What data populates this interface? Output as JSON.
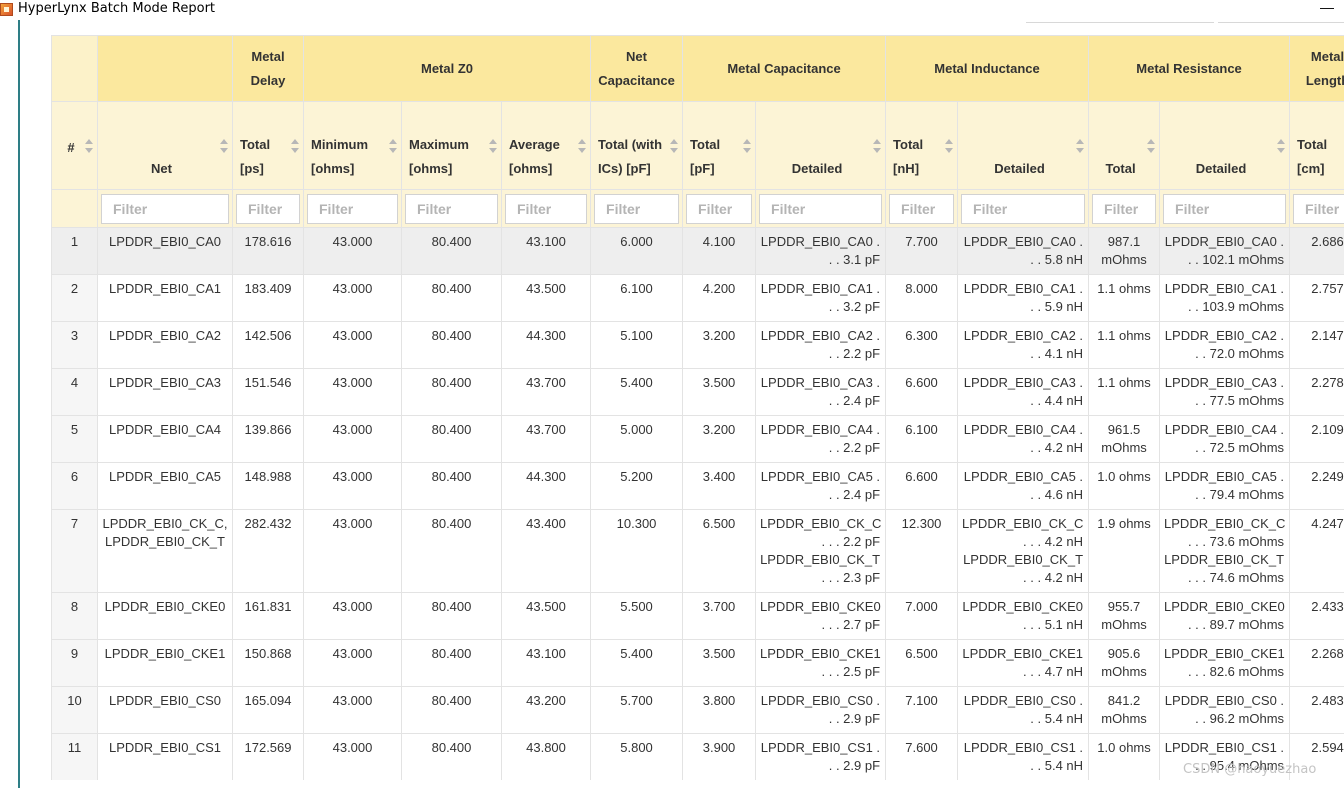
{
  "window": {
    "title": "HyperLynx Batch Mode Report",
    "minimize_glyph": "—",
    "app_icon": "hyperlynx-app-icon"
  },
  "header": {
    "groups": [
      "",
      "",
      "Metal Delay",
      "Metal Z0",
      "Net Capacitance",
      "Metal Capacitance",
      "Metal Inductance",
      "Metal Resistance",
      "Metal Length"
    ],
    "columns": [
      "#",
      "Net",
      "Total [ps]",
      "Minimum [ohms]",
      "Maximum [ohms]",
      "Average [ohms]",
      "Total (with ICs) [pF]",
      "Total [pF]",
      "Detailed",
      "Total [nH]",
      "Detailed",
      "Total",
      "Detailed",
      "Total [cm]"
    ]
  },
  "filter_placeholder": "Filter",
  "rows": [
    {
      "num": "1",
      "net": "LPDDR_EBI0_CA0",
      "delay": "178.616",
      "z0_min": "43.000",
      "z0_max": "80.400",
      "z0_avg": "43.100",
      "net_cap": "6.000",
      "cap_total": "4.100",
      "cap_detail": "LPDDR_EBI0_CA0 . . . 3.1 pF",
      "ind_total": "7.700",
      "ind_detail": "LPDDR_EBI0_CA0 . . . 5.8 nH",
      "res_total": "987.1 mOhms",
      "res_detail": "LPDDR_EBI0_CA0 . . . 102.1 mOhms",
      "len_total": "2.686"
    },
    {
      "num": "2",
      "net": "LPDDR_EBI0_CA1",
      "delay": "183.409",
      "z0_min": "43.000",
      "z0_max": "80.400",
      "z0_avg": "43.500",
      "net_cap": "6.100",
      "cap_total": "4.200",
      "cap_detail": "LPDDR_EBI0_CA1 . . . 3.2 pF",
      "ind_total": "8.000",
      "ind_detail": "LPDDR_EBI0_CA1 . . . 5.9 nH",
      "res_total": "1.1 ohms",
      "res_detail": "LPDDR_EBI0_CA1 . . . 103.9 mOhms",
      "len_total": "2.757"
    },
    {
      "num": "3",
      "net": "LPDDR_EBI0_CA2",
      "delay": "142.506",
      "z0_min": "43.000",
      "z0_max": "80.400",
      "z0_avg": "44.300",
      "net_cap": "5.100",
      "cap_total": "3.200",
      "cap_detail": "LPDDR_EBI0_CA2 . . . 2.2 pF",
      "ind_total": "6.300",
      "ind_detail": "LPDDR_EBI0_CA2 . . . 4.1 nH",
      "res_total": "1.1 ohms",
      "res_detail": "LPDDR_EBI0_CA2 . . . 72.0 mOhms",
      "len_total": "2.147"
    },
    {
      "num": "4",
      "net": "LPDDR_EBI0_CA3",
      "delay": "151.546",
      "z0_min": "43.000",
      "z0_max": "80.400",
      "z0_avg": "43.700",
      "net_cap": "5.400",
      "cap_total": "3.500",
      "cap_detail": "LPDDR_EBI0_CA3 . . . 2.4 pF",
      "ind_total": "6.600",
      "ind_detail": "LPDDR_EBI0_CA3 . . . 4.4 nH",
      "res_total": "1.1 ohms",
      "res_detail": "LPDDR_EBI0_CA3 . . . 77.5 mOhms",
      "len_total": "2.278"
    },
    {
      "num": "5",
      "net": "LPDDR_EBI0_CA4",
      "delay": "139.866",
      "z0_min": "43.000",
      "z0_max": "80.400",
      "z0_avg": "43.700",
      "net_cap": "5.000",
      "cap_total": "3.200",
      "cap_detail": "LPDDR_EBI0_CA4 . . . 2.2 pF",
      "ind_total": "6.100",
      "ind_detail": "LPDDR_EBI0_CA4 . . . 4.2 nH",
      "res_total": "961.5 mOhms",
      "res_detail": "LPDDR_EBI0_CA4 . . . 72.5 mOhms",
      "len_total": "2.109"
    },
    {
      "num": "6",
      "net": "LPDDR_EBI0_CA5",
      "delay": "148.988",
      "z0_min": "43.000",
      "z0_max": "80.400",
      "z0_avg": "44.300",
      "net_cap": "5.200",
      "cap_total": "3.400",
      "cap_detail": "LPDDR_EBI0_CA5 . . . 2.4 pF",
      "ind_total": "6.600",
      "ind_detail": "LPDDR_EBI0_CA5 . . . 4.6 nH",
      "res_total": "1.0 ohms",
      "res_detail": "LPDDR_EBI0_CA5 . . . 79.4 mOhms",
      "len_total": "2.249"
    },
    {
      "num": "7",
      "net": "LPDDR_EBI0_CK_C, LPDDR_EBI0_CK_T",
      "delay": "282.432",
      "z0_min": "43.000",
      "z0_max": "80.400",
      "z0_avg": "43.400",
      "net_cap": "10.300",
      "cap_total": "6.500",
      "cap_detail": "LPDDR_EBI0_CK_C . . . 2.2 pF LPDDR_EBI0_CK_T . . . 2.3 pF",
      "ind_total": "12.300",
      "ind_detail": "LPDDR_EBI0_CK_C . . . 4.2 nH LPDDR_EBI0_CK_T . . . 4.2 nH",
      "res_total": "1.9 ohms",
      "res_detail": "LPDDR_EBI0_CK_C . . . 73.6 mOhms LPDDR_EBI0_CK_T . . . 74.6 mOhms",
      "len_total": "4.247"
    },
    {
      "num": "8",
      "net": "LPDDR_EBI0_CKE0",
      "delay": "161.831",
      "z0_min": "43.000",
      "z0_max": "80.400",
      "z0_avg": "43.500",
      "net_cap": "5.500",
      "cap_total": "3.700",
      "cap_detail": "LPDDR_EBI0_CKE0 . . . 2.7 pF",
      "ind_total": "7.000",
      "ind_detail": "LPDDR_EBI0_CKE0 . . . 5.1 nH",
      "res_total": "955.7 mOhms",
      "res_detail": "LPDDR_EBI0_CKE0 . . . 89.7 mOhms",
      "len_total": "2.433"
    },
    {
      "num": "9",
      "net": "LPDDR_EBI0_CKE1",
      "delay": "150.868",
      "z0_min": "43.000",
      "z0_max": "80.400",
      "z0_avg": "43.100",
      "net_cap": "5.400",
      "cap_total": "3.500",
      "cap_detail": "LPDDR_EBI0_CKE1 . . . 2.5 pF",
      "ind_total": "6.500",
      "ind_detail": "LPDDR_EBI0_CKE1 . . . 4.7 nH",
      "res_total": "905.6 mOhms",
      "res_detail": "LPDDR_EBI0_CKE1 . . . 82.6 mOhms",
      "len_total": "2.268"
    },
    {
      "num": "10",
      "net": "LPDDR_EBI0_CS0",
      "delay": "165.094",
      "z0_min": "43.000",
      "z0_max": "80.400",
      "z0_avg": "43.200",
      "net_cap": "5.700",
      "cap_total": "3.800",
      "cap_detail": "LPDDR_EBI0_CS0 . . . 2.9 pF",
      "ind_total": "7.100",
      "ind_detail": "LPDDR_EBI0_CS0 . . . 5.4 nH",
      "res_total": "841.2 mOhms",
      "res_detail": "LPDDR_EBI0_CS0 . . . 96.2 mOhms",
      "len_total": "2.483"
    },
    {
      "num": "11",
      "net": "LPDDR_EBI0_CS1",
      "delay": "172.569",
      "z0_min": "43.000",
      "z0_max": "80.400",
      "z0_avg": "43.800",
      "net_cap": "5.800",
      "cap_total": "3.900",
      "cap_detail": "LPDDR_EBI0_CS1 . . . 2.9 pF",
      "ind_total": "7.600",
      "ind_detail": "LPDDR_EBI0_CS1 . . . 5.4 nH",
      "res_total": "1.0 ohms",
      "res_detail": "LPDDR_EBI0_CS1 . . . 95.4 mOhms",
      "len_total": "2.594"
    }
  ],
  "watermark": "CSDN @haoyuezhao",
  "colors": {
    "group_header": "#fbe89e",
    "column_header": "#fcf4d6",
    "selected_row": "#eeeeee",
    "left_border": "#2e7e86"
  }
}
